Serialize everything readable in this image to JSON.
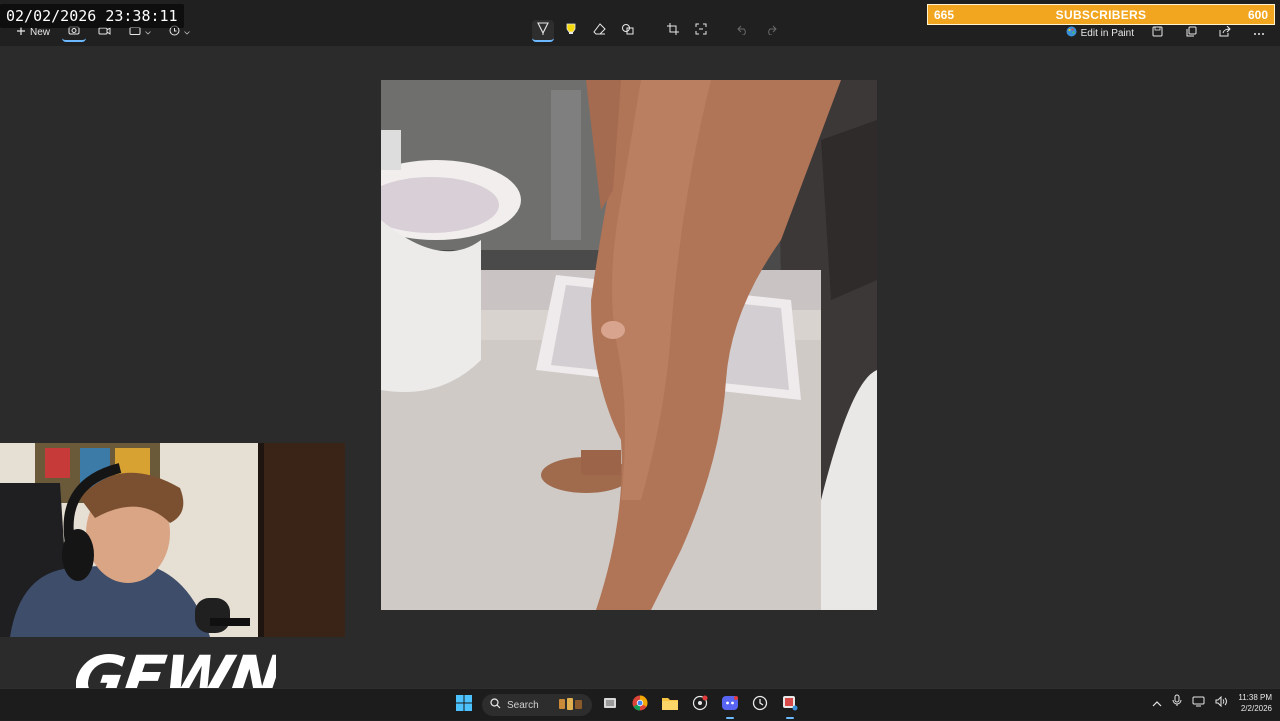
{
  "overlay": {
    "timestamp": "02/02/2026 23:38:11",
    "subscriber_goal": {
      "current": "665",
      "label": "SUBSCRIBERS",
      "goal": "600",
      "bar_color": "#f2a51e"
    },
    "logo_text": "GEWN"
  },
  "toolbar": {
    "new_label": "New",
    "left_icons": [
      "camera-icon",
      "video-icon",
      "rectangle-mode-icon",
      "timer-icon"
    ],
    "center_icons": [
      "ballpoint-pen-icon",
      "highlighter-icon",
      "eraser-icon",
      "shapes-icon",
      "crop-icon",
      "text-actions-icon",
      "undo-icon",
      "redo-icon"
    ],
    "edit_in_paint_label": "Edit in Paint",
    "right_icons": [
      "save-icon",
      "copy-icon",
      "share-icon",
      "more-icon"
    ],
    "accent_color": "#6cb8ff"
  },
  "taskbar": {
    "search_label": "Search",
    "apps": [
      "start-icon",
      "search",
      "widgets-icon",
      "task-view-icon",
      "chrome-icon",
      "file-explorer-icon",
      "app-icon",
      "discord-icon",
      "clock-app-icon",
      "snipping-tool-icon"
    ],
    "tray_icons": [
      "chevron-up-icon",
      "microphone-icon",
      "network-icon",
      "volume-icon"
    ],
    "time": "11:38 PM",
    "date": "2/2/2026"
  }
}
